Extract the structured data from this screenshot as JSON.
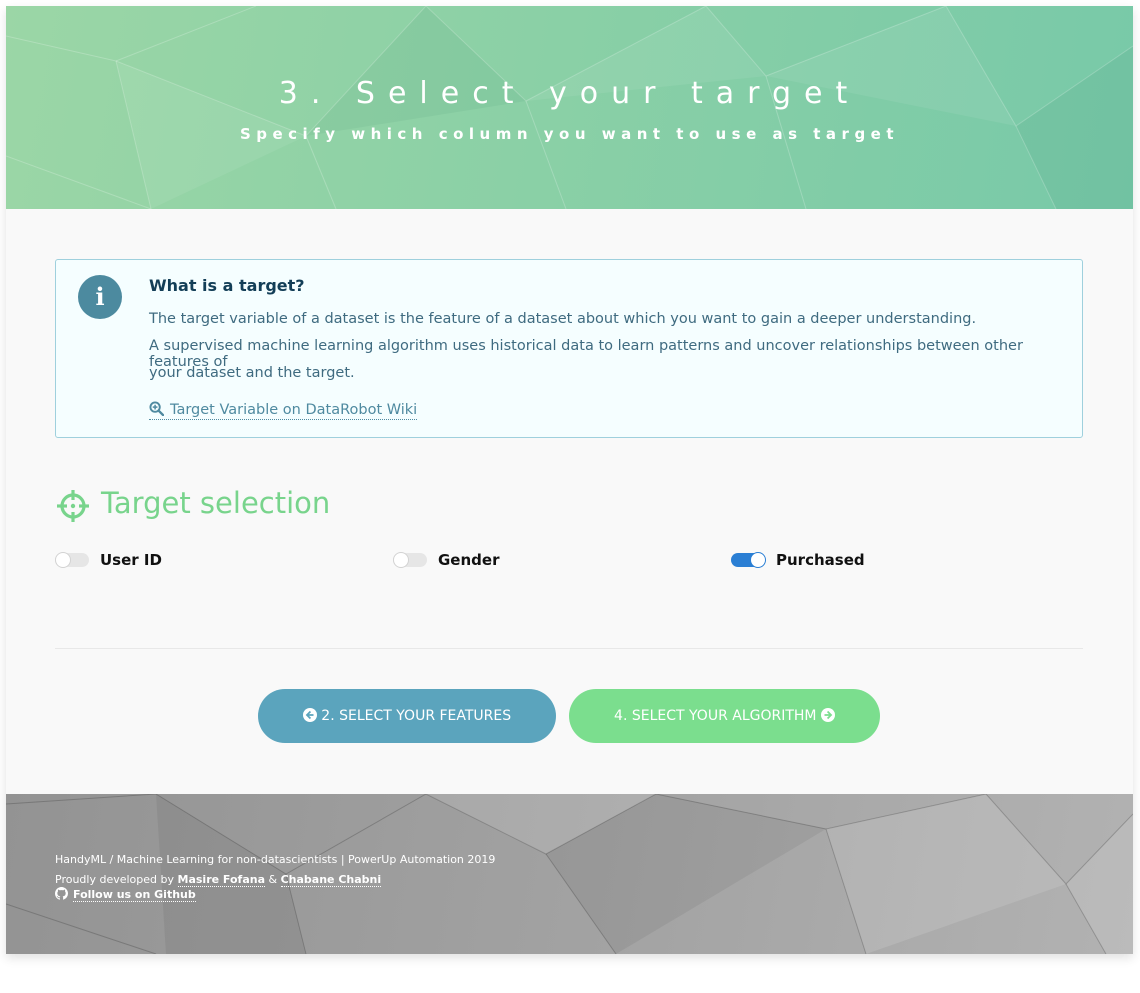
{
  "header": {
    "title": "3. Select your target",
    "subtitle": "Specify which column you want to use as target"
  },
  "info": {
    "icon": "info-icon",
    "title": "What is a target?",
    "line1": "The target variable of a dataset is the feature of a dataset about which you want to gain a deeper understanding.",
    "line2": "A supervised machine learning algorithm uses historical data to learn patterns and uncover relationships between other features of",
    "line3": "your dataset and the target.",
    "link_label": "Target Variable on DataRobot Wiki",
    "link_icon": "search-plus-icon"
  },
  "section": {
    "icon": "crosshairs-icon",
    "title": "Target selection"
  },
  "columns": [
    {
      "label": "User ID",
      "selected": false
    },
    {
      "label": "Gender",
      "selected": false
    },
    {
      "label": "Purchased",
      "selected": true
    }
  ],
  "nav": {
    "prev_label": "2. SELECT YOUR FEATURES",
    "prev_icon": "arrow-circle-left-icon",
    "next_label": "4. SELECT YOUR ALGORITHM",
    "next_icon": "arrow-circle-right-icon"
  },
  "footer": {
    "line1": "HandyML / Machine Learning for non-datascientists | PowerUp Automation 2019",
    "dev_prefix": "Proudly developed by",
    "dev1": "Masire Fofana",
    "dev_sep": "&",
    "dev2": "Chabane Chabni",
    "github_label": "Follow us on Github",
    "github_icon": "github-icon"
  },
  "colors": {
    "header_green": "#8dd1a6",
    "info_icon": "#4c8a9f",
    "section_green": "#78d48c",
    "toggle_on": "#2b7fd4",
    "btn_prev": "#5ba4bd",
    "btn_next": "#7bde8e"
  }
}
